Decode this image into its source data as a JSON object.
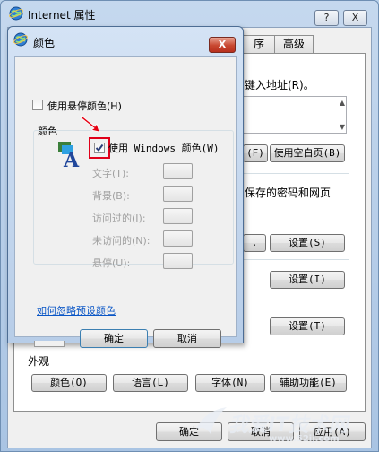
{
  "outer_window": {
    "title": "Internet 属性",
    "help_btn": "?",
    "close_btn": "X",
    "tabs": [
      "序",
      "高级"
    ],
    "address_prompt": "键入地址(R)。",
    "home_buttons": [
      "(F)",
      "使用空白页(B)"
    ],
    "history_text": "保存的密码和网页",
    "delete_row_btns": [
      ".",
      "设置(S)"
    ],
    "settings_btn_1": "设置(I)",
    "settings_btn_2": "设置(T)",
    "appearance_label": "外观",
    "appearance_buttons": [
      "颜色(O)",
      "语言(L)",
      "字体(N)",
      "辅助功能(E)"
    ],
    "footer_buttons": [
      "确定",
      "取消",
      "应用(A)"
    ]
  },
  "colors_dialog": {
    "title": "颜色",
    "close_btn": "X",
    "use_hover_label": "使用悬停颜色(H)",
    "group_label": "颜色",
    "use_windows_label": "使用 Windows 颜色(W)",
    "rows": [
      {
        "label": "文字(T):"
      },
      {
        "label": "背景(B):"
      },
      {
        "label": "访问过的(I):"
      },
      {
        "label": "未访问的(N):"
      },
      {
        "label": "悬停(U):"
      }
    ],
    "link": "如何忽略预设颜色",
    "ok_btn": "确定",
    "cancel_btn": "取消"
  },
  "watermark": {
    "line1": "我爱IT技术网",
    "line2": "www.52ij.com"
  },
  "colors": {
    "highlight": "#e0001a",
    "arrow": "#e60012",
    "link": "#0a56c6"
  }
}
